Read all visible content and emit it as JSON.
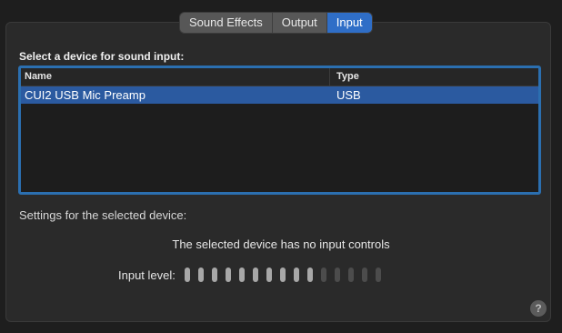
{
  "tabs": [
    {
      "label": "Sound Effects",
      "active": false
    },
    {
      "label": "Output",
      "active": false
    },
    {
      "label": "Input",
      "active": true
    }
  ],
  "device_section": {
    "title": "Select a device for sound input:",
    "columns": {
      "name": "Name",
      "type": "Type"
    },
    "rows": [
      {
        "name": "CUI2 USB Mic Preamp",
        "type": "USB",
        "selected": true
      }
    ]
  },
  "settings": {
    "title": "Settings for the selected device:",
    "no_controls_text": "The selected device has no input controls",
    "input_level_label": "Input level:",
    "input_level_segments_total": 15,
    "input_level_segments_lit": 10
  },
  "help": {
    "label": "?"
  },
  "colors": {
    "accent": "#2f6ec7",
    "selection": "#2b5aa0",
    "focus_ring": "#2b6fb0"
  }
}
